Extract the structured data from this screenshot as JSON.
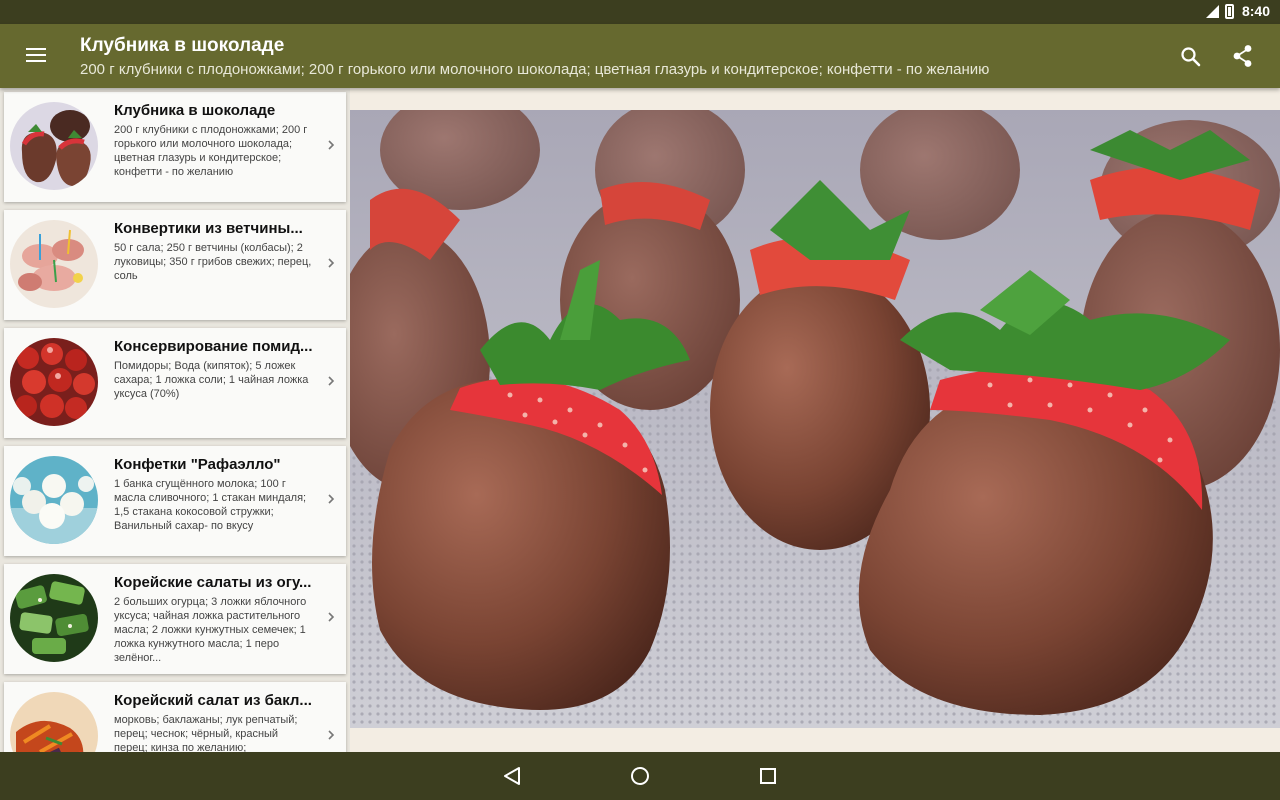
{
  "status_bar": {
    "time": "8:40"
  },
  "app_bar": {
    "title": "Клубника в шоколаде",
    "subtitle": "200 г клубники с плодоножками; 200 г горького или молочного шоколада; цветная глазурь и кондитерское; конфетти - по желанию",
    "icons": [
      "menu-icon",
      "search-icon",
      "share-icon"
    ]
  },
  "recipes": [
    {
      "title": "Клубника в шоколаде",
      "description": "200 г клубники с плодоножками; 200 г горького или молочного шоколада; цветная глазурь и кондитерское; конфетти - по желанию"
    },
    {
      "title": "Конвертики из ветчины...",
      "description": "50 г сала; 250 г ветчины (колбасы); 2 луковицы; 350 г грибов свежих; перец, соль"
    },
    {
      "title": "Консервирование помид...",
      "description": "Помидоры; Вода (кипяток); 5 ложек сахара; 1 ложка соли; 1 чайная ложка уксуса (70%)"
    },
    {
      "title": "Конфетки \"Рафаэлло\"",
      "description": "1 банка сгущённого молока; 100 г масла сливочного; 1 стакан миндаля; 1,5 стакана кокосовой стружки; Ванильный сахар- по вкусу"
    },
    {
      "title": "Корейские салаты из огу...",
      "description": "2 больших огурца; 3 ложки яблочного уксуса; чайная ложка растительного масла; 2 ложки кунжутных семечек; 1 ложка кунжутного масла; 1 перо зелёног..."
    },
    {
      "title": "Корейский салат из бакл...",
      "description": "морковь; баклажаны; лук репчатый; перец; чеснок; чёрный, красный перец; кинза по желанию;"
    }
  ],
  "nav_bar": {
    "icons": [
      "back-icon",
      "home-icon",
      "recents-icon"
    ]
  },
  "colors": {
    "status_bar": "#3c3e1f",
    "app_bar": "#66692f",
    "card": "#fafaf8",
    "sidebar_bg": "#e9e6de"
  }
}
